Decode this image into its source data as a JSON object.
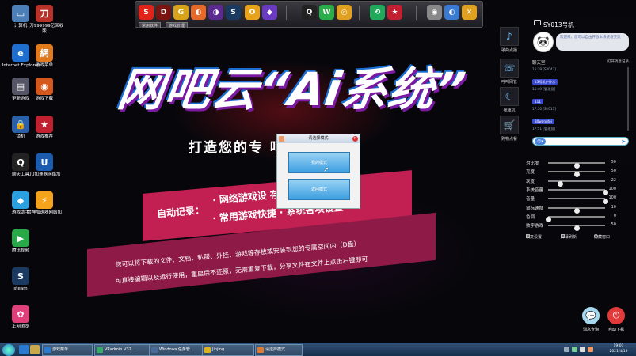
{
  "desktop_icons": [
    {
      "label": "计算机",
      "glyph": "▭",
      "color": "#4c7fb8"
    },
    {
      "label": "一刀999999亿回收版",
      "glyph": "刀",
      "color": "#b8322a"
    },
    {
      "label": "Internet Explorer",
      "glyph": "e",
      "color": "#1e6fd0"
    },
    {
      "label": "游戏菜单",
      "glyph": "網",
      "color": "#e07a1c"
    },
    {
      "label": "更新游戏",
      "glyph": "▤",
      "color": "#556"
    },
    {
      "label": "游戏下载",
      "glyph": "◉",
      "color": "#d4581c"
    },
    {
      "label": "锁机",
      "glyph": "🔒",
      "color": "#2a5faa"
    },
    {
      "label": "游戏推荐",
      "glyph": "★",
      "color": "#c02030"
    },
    {
      "label": "聊天工具",
      "glyph": "Q",
      "color": "#222"
    },
    {
      "label": "UU加速器网络加",
      "glyph": "U",
      "color": "#1c5cb0"
    },
    {
      "label": "游戏助手",
      "glyph": "◆",
      "color": "#2aa0e0"
    },
    {
      "label": "雷神加速器网络加",
      "glyph": "⚡",
      "color": "#f5a21c"
    },
    {
      "label": "腾讯视频",
      "glyph": "▶",
      "color": "#29a84a"
    },
    {
      "label": "steam",
      "glyph": "S",
      "color": "#1b3a62"
    },
    {
      "label": "上网浏览",
      "glyph": "✿",
      "color": "#e0407a"
    }
  ],
  "dock": {
    "apps": [
      {
        "glyph": "S",
        "color": "#e2231a"
      },
      {
        "glyph": "D",
        "color": "#7a1410"
      },
      {
        "glyph": "G",
        "color": "#d8a21a"
      },
      {
        "glyph": "◐",
        "color": "#e56a2a"
      },
      {
        "glyph": "◑",
        "color": "#5a2a90"
      },
      {
        "glyph": "S",
        "color": "#1b3a62"
      },
      {
        "glyph": "O",
        "color": "#e8a21c"
      },
      {
        "glyph": "◆",
        "color": "#6a3ac0"
      },
      {
        "glyph": "Q",
        "color": "#222"
      },
      {
        "glyph": "W",
        "color": "#2aae4a"
      },
      {
        "glyph": "◎",
        "color": "#e0a020"
      },
      {
        "glyph": "⟲",
        "color": "#22a85a"
      },
      {
        "glyph": "★",
        "color": "#c02030"
      },
      {
        "glyph": "◉",
        "color": "#888"
      },
      {
        "glyph": "◐",
        "color": "#3a7ad0"
      },
      {
        "glyph": "✕",
        "color": "#e0a020"
      }
    ],
    "tabs": [
      "常用软件",
      "游戏管理"
    ]
  },
  "headline": "网吧云“Ai系统”",
  "subtitle": "打造您的专    吧电脑",
  "banner": {
    "label": "自动记录：",
    "line1": "· 网络游戏设        存档",
    "line2": "· 常用游戏快捷    · 系统各项设置",
    "desc1": "您可以将下载的文件、文档、私服、外挂、游戏等存放或安装到您的专属空间内（D盘）",
    "desc2": "可直接编辑以及运行使用，重启后不还原，无需重复下载，分享文件在文件上点击右键即可"
  },
  "dialog": {
    "title": "请选择模式",
    "btn1": "我的模式",
    "btn2": "返回模式"
  },
  "right_panel": {
    "pc_title": "SY013号机",
    "notice": "欢迎来，您可以自由开放本系统与交流",
    "chat_title": "聊天室",
    "chat_right": "打开消息记录",
    "messages": [
      {
        "meta": "15:39 [SY043]",
        "text": "43号机户外水"
      },
      {
        "meta": "15:49 [管理员]",
        "text": "111"
      },
      {
        "meta": "17:50 [SY013]",
        "text": "30wangfei"
      },
      {
        "meta": "17:51 [管理员]",
        "text": "1"
      }
    ],
    "side_buttons": [
      {
        "label": "歌曲点播",
        "glyph": "♪"
      },
      {
        "label": "呼叫网管",
        "glyph": "☏"
      },
      {
        "label": "我锁机",
        "glyph": "☾"
      },
      {
        "label": "购物点餐",
        "glyph": "🛒"
      }
    ],
    "emoji_label": "☺▾",
    "send_glyph": "➤",
    "sliders": [
      {
        "label": "对比度",
        "value": 50,
        "max": 100
      },
      {
        "label": "亮度",
        "value": 50,
        "max": 100
      },
      {
        "label": "灰度",
        "value": 22,
        "max": 100
      },
      {
        "label": "系统音量",
        "value": 100,
        "max": 100
      },
      {
        "label": "音量",
        "value": 100,
        "max": 100
      },
      {
        "label": "鼠标速度",
        "value": 10,
        "max": 20
      },
      {
        "label": "色调",
        "value": 0,
        "max": 100
      },
      {
        "label": "数字游戏",
        "value": 50,
        "max": 100
      }
    ],
    "options": [
      "恢复设置",
      "屏幕刷新",
      "隐藏窗口"
    ],
    "bottom_buttons": [
      {
        "label": "消息查询",
        "glyph": "💬",
        "color": "#a8d8f0"
      },
      {
        "label": "自动下机",
        "glyph": "⏻",
        "color": "#e23a3a"
      }
    ]
  },
  "taskbar": {
    "items": [
      {
        "label": "游戏菜单",
        "color": "#2a7ad0"
      },
      {
        "label": "VRadmin V32...",
        "color": "#3aa86a"
      },
      {
        "label": "Windows 任务管...",
        "color": "#4a6a9a"
      },
      {
        "label": "Jinjing",
        "color": "#e0b020"
      },
      {
        "label": "请选择模式",
        "color": "#e07a30"
      }
    ],
    "clock_time": "19:01",
    "clock_date": "2021/4/19"
  }
}
